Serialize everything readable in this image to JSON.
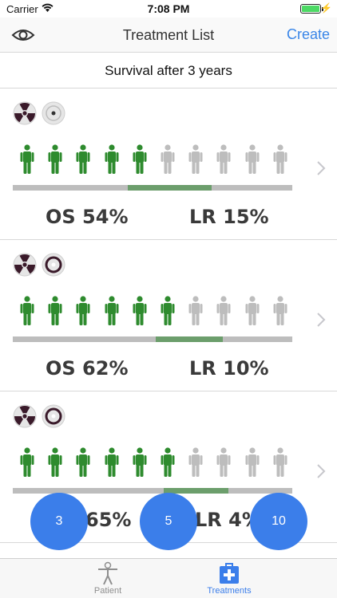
{
  "status_bar": {
    "carrier": "Carrier",
    "time": "7:08 PM"
  },
  "nav": {
    "title": "Treatment List",
    "create_label": "Create",
    "eye_icon": "eye-icon"
  },
  "section": {
    "title": "Survival after 3 years"
  },
  "colors": {
    "accent": "#3b7eea",
    "survivor": "#2e8b2e",
    "inactive": "#bdbdbd",
    "range": "#6c9e6c",
    "radiation": "#3a1a2a"
  },
  "treatments": [
    {
      "icons": [
        "radiation-icon",
        "target-icon"
      ],
      "survivors_of_10": 5,
      "range_fraction": [
        0.41,
        0.71
      ],
      "os": "OS 54%",
      "lr": "LR 15%"
    },
    {
      "icons": [
        "radiation-icon",
        "target-icon"
      ],
      "survivors_of_10": 6,
      "range_fraction": [
        0.51,
        0.75
      ],
      "os": "OS 62%",
      "lr": "LR 10%"
    },
    {
      "icons": [
        "radiation-icon",
        "target-icon"
      ],
      "survivors_of_10": 6,
      "range_fraction": [
        0.54,
        0.77
      ],
      "os": "65%",
      "lr": "LR 4%"
    }
  ],
  "fabs": [
    "3",
    "5",
    "10"
  ],
  "tabs": [
    {
      "label": "Patient",
      "icon": "person-icon",
      "active": false
    },
    {
      "label": "Treatments",
      "icon": "medical-kit-icon",
      "active": true
    }
  ]
}
